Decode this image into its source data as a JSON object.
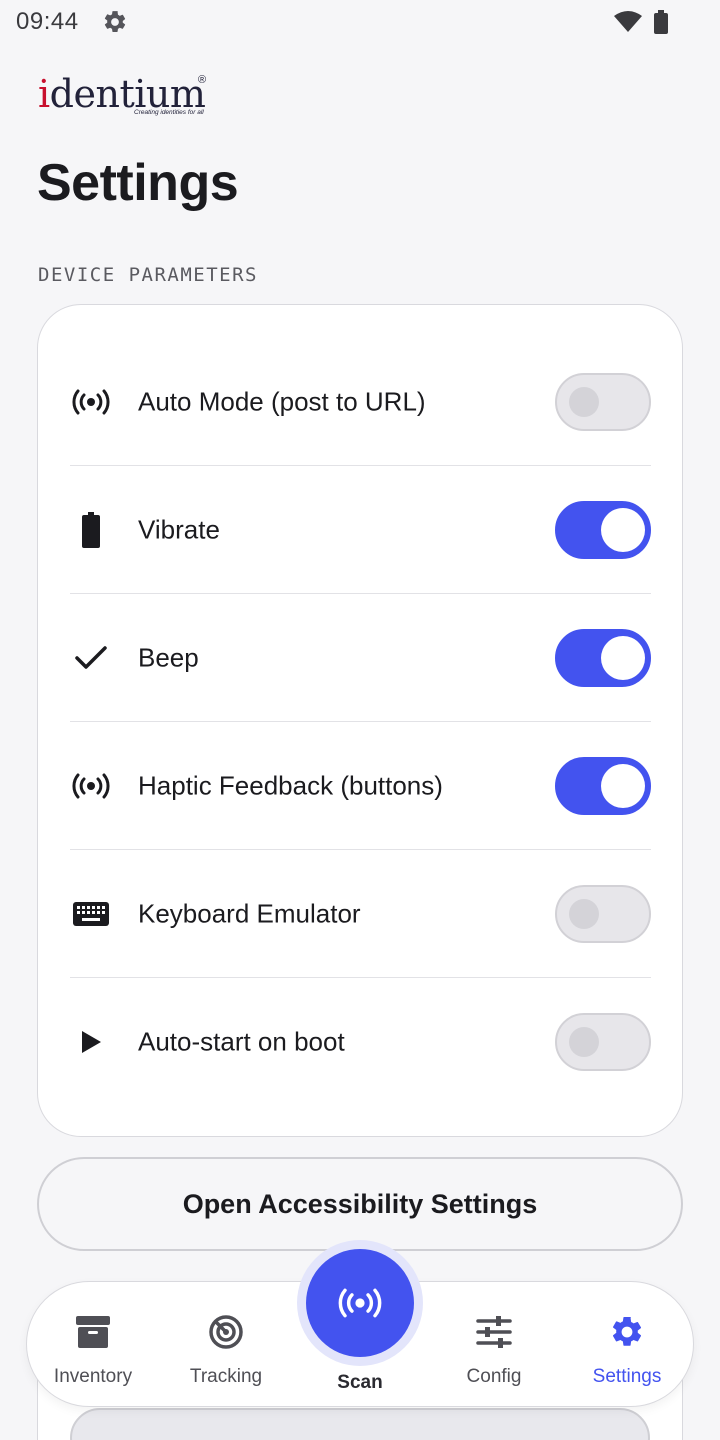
{
  "status_bar": {
    "time": "09:44",
    "icons": [
      "gear-icon",
      "wifi-icon",
      "battery-icon"
    ]
  },
  "logo": {
    "brand": "identium",
    "tagline": "Creating identities for all",
    "registered": "®"
  },
  "page": {
    "title": "Settings",
    "section_header": "DEVICE PARAMETERS"
  },
  "settings": [
    {
      "icon": "broadcast-icon",
      "label": "Auto Mode (post to URL)",
      "enabled": false
    },
    {
      "icon": "battery-icon",
      "label": "Vibrate",
      "enabled": true
    },
    {
      "icon": "check-icon",
      "label": "Beep",
      "enabled": true
    },
    {
      "icon": "broadcast-icon",
      "label": "Haptic Feedback (buttons)",
      "enabled": true
    },
    {
      "icon": "keyboard-icon",
      "label": "Keyboard Emulator",
      "enabled": false
    },
    {
      "icon": "play-icon",
      "label": "Auto-start on boot",
      "enabled": false
    }
  ],
  "accessibility_button": {
    "label": "Open Accessibility Settings"
  },
  "bottom_nav": {
    "items": [
      {
        "icon": "archive-icon",
        "label": "Inventory",
        "active": false
      },
      {
        "icon": "radar-icon",
        "label": "Tracking",
        "active": false
      },
      {
        "icon": "broadcast-icon",
        "label": "Scan",
        "active": false
      },
      {
        "icon": "sliders-icon",
        "label": "Config",
        "active": false
      },
      {
        "icon": "gear-icon",
        "label": "Settings",
        "active": true
      }
    ]
  },
  "colors": {
    "accent": "#4353ef",
    "toggle_off": "#e7e6ea",
    "text": "#1b1b1f",
    "background": "#f6f6f8"
  }
}
